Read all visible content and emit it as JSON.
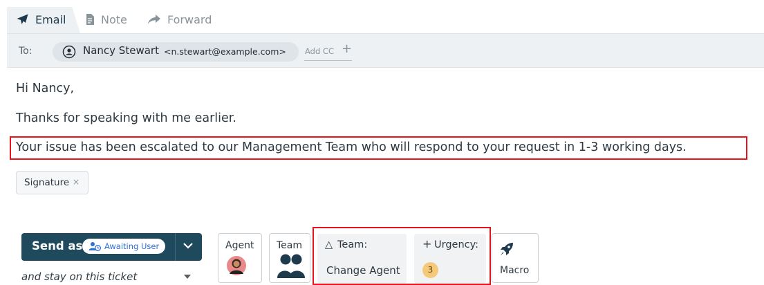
{
  "tabs": [
    {
      "label": "Email",
      "icon": "paper-plane-icon"
    },
    {
      "label": "Note",
      "icon": "note-icon"
    },
    {
      "label": "Forward",
      "icon": "forward-arrow-icon"
    }
  ],
  "recipients": {
    "to_label": "To:",
    "name": "Nancy Stewart",
    "email": "<n.stewart@example.com>",
    "add_cc": "Add CC",
    "add_cc_plus": "+"
  },
  "message": {
    "greeting": "Hi Nancy,",
    "line1": "Thanks for speaking with me earlier.",
    "line2": "Your issue has been escalated to our Management Team who will respond to your request in 1-3 working days."
  },
  "signature": {
    "label": "Signature",
    "remove": "×"
  },
  "send": {
    "label": "Send as",
    "status": "Awaiting User",
    "stay": "and stay on this ticket"
  },
  "tools": {
    "agent": "Agent",
    "team": "Team",
    "macro": "Macro"
  },
  "panels": {
    "team_prefix": "△",
    "team_title": "Team:",
    "team_value": "Change Agent",
    "urgency_prefix": "+",
    "urgency_title": "Urgency:",
    "urgency_value": "3"
  },
  "colors": {
    "accent": "#1f4a5e",
    "highlight": "#e8121c",
    "status_text": "#2f6fd6",
    "urgency": "#f5c97a"
  }
}
